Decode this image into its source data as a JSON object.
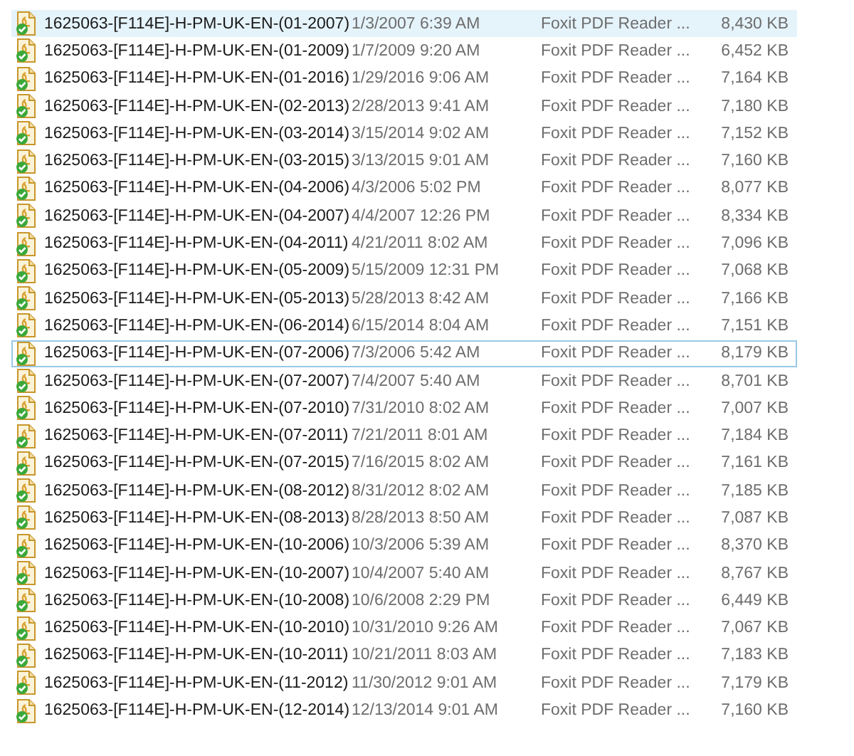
{
  "files": [
    {
      "name": "1625063-[F114E]-H-PM-UK-EN-(01-2007)",
      "date": "1/3/2007 6:39 AM",
      "type": "Foxit PDF Reader ...",
      "size": "8,430 KB",
      "selected": true,
      "focused": false
    },
    {
      "name": "1625063-[F114E]-H-PM-UK-EN-(01-2009)",
      "date": "1/7/2009 9:20 AM",
      "type": "Foxit PDF Reader ...",
      "size": "6,452 KB",
      "selected": false,
      "focused": false
    },
    {
      "name": "1625063-[F114E]-H-PM-UK-EN-(01-2016)",
      "date": "1/29/2016 9:06 AM",
      "type": "Foxit PDF Reader ...",
      "size": "7,164 KB",
      "selected": false,
      "focused": false
    },
    {
      "name": "1625063-[F114E]-H-PM-UK-EN-(02-2013)",
      "date": "2/28/2013 9:41 AM",
      "type": "Foxit PDF Reader ...",
      "size": "7,180 KB",
      "selected": false,
      "focused": false
    },
    {
      "name": "1625063-[F114E]-H-PM-UK-EN-(03-2014)",
      "date": "3/15/2014 9:02 AM",
      "type": "Foxit PDF Reader ...",
      "size": "7,152 KB",
      "selected": false,
      "focused": false
    },
    {
      "name": "1625063-[F114E]-H-PM-UK-EN-(03-2015)",
      "date": "3/13/2015 9:01 AM",
      "type": "Foxit PDF Reader ...",
      "size": "7,160 KB",
      "selected": false,
      "focused": false
    },
    {
      "name": "1625063-[F114E]-H-PM-UK-EN-(04-2006)",
      "date": "4/3/2006 5:02 PM",
      "type": "Foxit PDF Reader ...",
      "size": "8,077 KB",
      "selected": false,
      "focused": false
    },
    {
      "name": "1625063-[F114E]-H-PM-UK-EN-(04-2007)",
      "date": "4/4/2007 12:26 PM",
      "type": "Foxit PDF Reader ...",
      "size": "8,334 KB",
      "selected": false,
      "focused": false
    },
    {
      "name": "1625063-[F114E]-H-PM-UK-EN-(04-2011)",
      "date": "4/21/2011 8:02 AM",
      "type": "Foxit PDF Reader ...",
      "size": "7,096 KB",
      "selected": false,
      "focused": false
    },
    {
      "name": "1625063-[F114E]-H-PM-UK-EN-(05-2009)",
      "date": "5/15/2009 12:31 PM",
      "type": "Foxit PDF Reader ...",
      "size": "7,068 KB",
      "selected": false,
      "focused": false
    },
    {
      "name": "1625063-[F114E]-H-PM-UK-EN-(05-2013)",
      "date": "5/28/2013 8:42 AM",
      "type": "Foxit PDF Reader ...",
      "size": "7,166 KB",
      "selected": false,
      "focused": false
    },
    {
      "name": "1625063-[F114E]-H-PM-UK-EN-(06-2014)",
      "date": "6/15/2014 8:04 AM",
      "type": "Foxit PDF Reader ...",
      "size": "7,151 KB",
      "selected": false,
      "focused": false
    },
    {
      "name": "1625063-[F114E]-H-PM-UK-EN-(07-2006)",
      "date": "7/3/2006 5:42 AM",
      "type": "Foxit PDF Reader ...",
      "size": "8,179 KB",
      "selected": false,
      "focused": true
    },
    {
      "name": "1625063-[F114E]-H-PM-UK-EN-(07-2007)",
      "date": "7/4/2007 5:40 AM",
      "type": "Foxit PDF Reader ...",
      "size": "8,701 KB",
      "selected": false,
      "focused": false
    },
    {
      "name": "1625063-[F114E]-H-PM-UK-EN-(07-2010)",
      "date": "7/31/2010 8:02 AM",
      "type": "Foxit PDF Reader ...",
      "size": "7,007 KB",
      "selected": false,
      "focused": false
    },
    {
      "name": "1625063-[F114E]-H-PM-UK-EN-(07-2011)",
      "date": "7/21/2011 8:01 AM",
      "type": "Foxit PDF Reader ...",
      "size": "7,184 KB",
      "selected": false,
      "focused": false
    },
    {
      "name": "1625063-[F114E]-H-PM-UK-EN-(07-2015)",
      "date": "7/16/2015 8:02 AM",
      "type": "Foxit PDF Reader ...",
      "size": "7,161 KB",
      "selected": false,
      "focused": false
    },
    {
      "name": "1625063-[F114E]-H-PM-UK-EN-(08-2012)",
      "date": "8/31/2012 8:02 AM",
      "type": "Foxit PDF Reader ...",
      "size": "7,185 KB",
      "selected": false,
      "focused": false
    },
    {
      "name": "1625063-[F114E]-H-PM-UK-EN-(08-2013)",
      "date": "8/28/2013 8:50 AM",
      "type": "Foxit PDF Reader ...",
      "size": "7,087 KB",
      "selected": false,
      "focused": false
    },
    {
      "name": "1625063-[F114E]-H-PM-UK-EN-(10-2006)",
      "date": "10/3/2006 5:39 AM",
      "type": "Foxit PDF Reader ...",
      "size": "8,370 KB",
      "selected": false,
      "focused": false
    },
    {
      "name": "1625063-[F114E]-H-PM-UK-EN-(10-2007)",
      "date": "10/4/2007 5:40 AM",
      "type": "Foxit PDF Reader ...",
      "size": "8,767 KB",
      "selected": false,
      "focused": false
    },
    {
      "name": "1625063-[F114E]-H-PM-UK-EN-(10-2008)",
      "date": "10/6/2008 2:29 PM",
      "type": "Foxit PDF Reader ...",
      "size": "6,449 KB",
      "selected": false,
      "focused": false
    },
    {
      "name": "1625063-[F114E]-H-PM-UK-EN-(10-2010)",
      "date": "10/31/2010 9:26 AM",
      "type": "Foxit PDF Reader ...",
      "size": "7,067 KB",
      "selected": false,
      "focused": false
    },
    {
      "name": "1625063-[F114E]-H-PM-UK-EN-(10-2011)",
      "date": "10/21/2011 8:03 AM",
      "type": "Foxit PDF Reader ...",
      "size": "7,183 KB",
      "selected": false,
      "focused": false
    },
    {
      "name": "1625063-[F114E]-H-PM-UK-EN-(11-2012)",
      "date": "11/30/2012 9:01 AM",
      "type": "Foxit PDF Reader ...",
      "size": "7,179 KB",
      "selected": false,
      "focused": false
    },
    {
      "name": "1625063-[F114E]-H-PM-UK-EN-(12-2014)",
      "date": "12/13/2014 9:01 AM",
      "type": "Foxit PDF Reader ...",
      "size": "7,160 KB",
      "selected": false,
      "focused": false
    }
  ]
}
